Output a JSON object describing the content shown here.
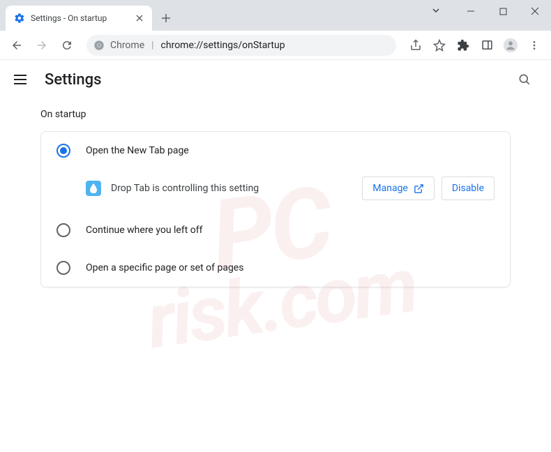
{
  "tab": {
    "title": "Settings - On startup"
  },
  "omnibox": {
    "host": "Chrome",
    "url": "chrome://settings/onStartup"
  },
  "header": {
    "title": "Settings"
  },
  "section": {
    "title": "On startup"
  },
  "options": {
    "newTab": "Open the New Tab page",
    "continue": "Continue where you left off",
    "specific": "Open a specific page or set of pages"
  },
  "extension": {
    "message": "Drop Tab is controlling this setting",
    "manage": "Manage",
    "disable": "Disable"
  },
  "watermark": {
    "l1": "PC",
    "l2": "risk.com"
  }
}
